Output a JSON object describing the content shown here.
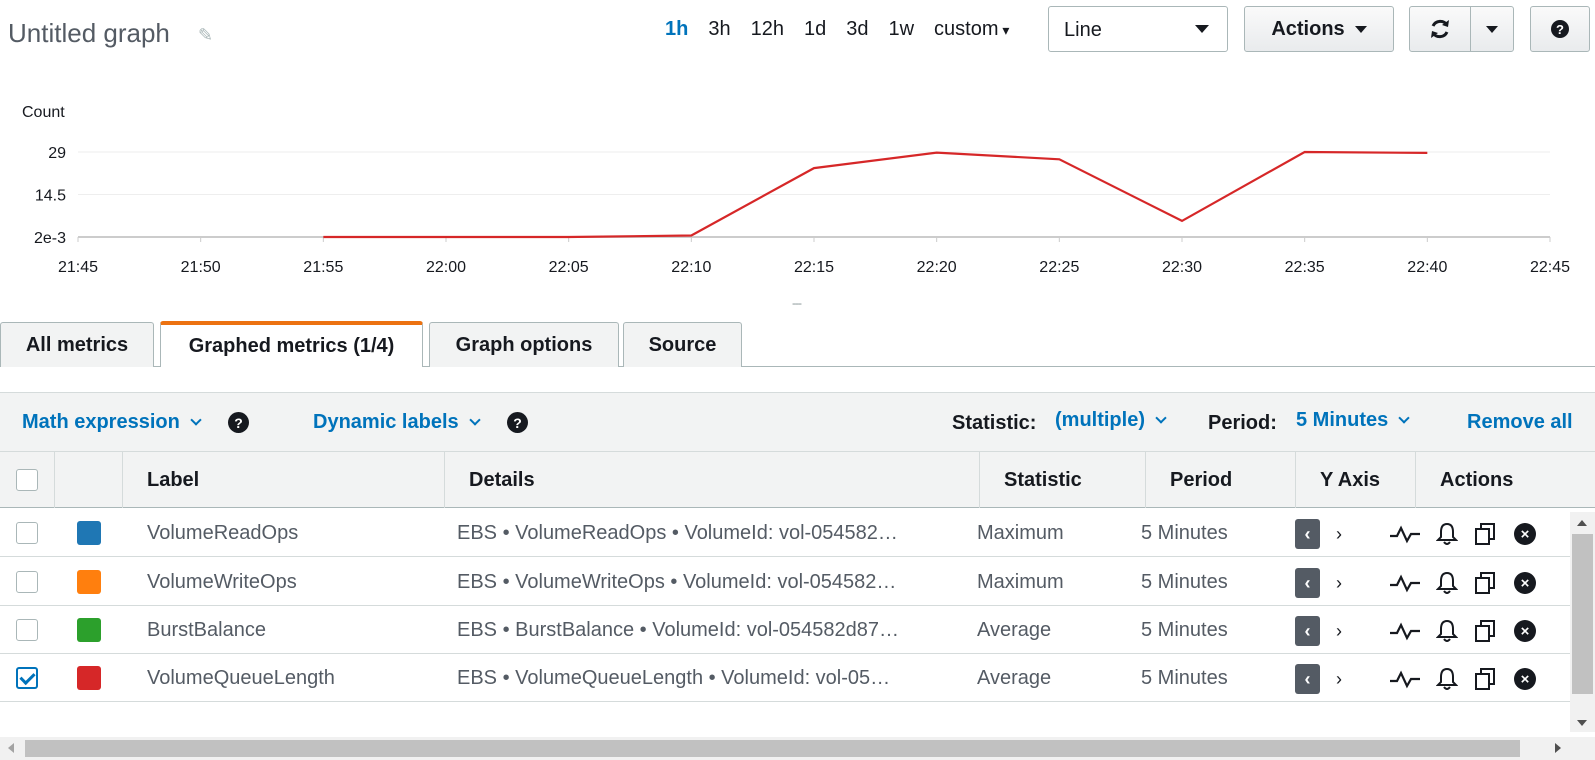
{
  "header": {
    "title": "Untitled graph",
    "ranges": [
      "1h",
      "3h",
      "12h",
      "1d",
      "3d",
      "1w",
      "custom"
    ],
    "active_range": "1h",
    "graph_type": "Line",
    "actions_label": "Actions",
    "help_label": "?"
  },
  "chart_data": {
    "type": "line",
    "ylabel": "Count",
    "y_ticks": [
      "29",
      "14.5",
      "2e-3"
    ],
    "ylim": [
      0.002,
      29
    ],
    "x_ticks": [
      "21:45",
      "21:50",
      "21:55",
      "22:00",
      "22:05",
      "22:10",
      "22:15",
      "22:20",
      "22:25",
      "22:30",
      "22:35",
      "22:40",
      "22:45"
    ],
    "series": [
      {
        "color": "#d62728",
        "x": [
          "21:55",
          "22:00",
          "22:05",
          "22:10",
          "22:15",
          "22:20",
          "22:25",
          "22:30",
          "22:35",
          "22:40"
        ],
        "values": [
          0.002,
          0.002,
          0.002,
          0.5,
          23.5,
          28.8,
          26.5,
          5.5,
          29,
          28.7
        ]
      }
    ],
    "grid": true,
    "footer": "---"
  },
  "tabs": [
    {
      "label": "All metrics",
      "active": false
    },
    {
      "label": "Graphed metrics (1/4)",
      "active": true
    },
    {
      "label": "Graph options",
      "active": false
    },
    {
      "label": "Source",
      "active": false
    }
  ],
  "toolbar": {
    "math_expression": "Math expression",
    "dynamic_labels": "Dynamic labels",
    "statistic_label": "Statistic:",
    "statistic_value": "(multiple)",
    "period_label": "Period:",
    "period_value": "5 Minutes",
    "remove_all": "Remove all"
  },
  "table": {
    "columns": [
      "Label",
      "Details",
      "Statistic",
      "Period",
      "Y Axis",
      "Actions"
    ],
    "rows": [
      {
        "checked": false,
        "color": "#1f77b4",
        "label": "VolumeReadOps",
        "details": "EBS • VolumeReadOps • VolumeId: vol-054582…",
        "statistic": "Maximum",
        "period": "5 Minutes"
      },
      {
        "checked": false,
        "color": "#ff7f0e",
        "label": "VolumeWriteOps",
        "details": "EBS • VolumeWriteOps • VolumeId: vol-054582…",
        "statistic": "Maximum",
        "period": "5 Minutes"
      },
      {
        "checked": false,
        "color": "#2ca02c",
        "label": "BurstBalance",
        "details": "EBS • BurstBalance • VolumeId: vol-054582d87…",
        "statistic": "Average",
        "period": "5 Minutes"
      },
      {
        "checked": true,
        "color": "#d62728",
        "label": "VolumeQueueLength",
        "details": "EBS • VolumeQueueLength • VolumeId: vol-05…",
        "statistic": "Average",
        "period": "5 Minutes"
      }
    ]
  }
}
